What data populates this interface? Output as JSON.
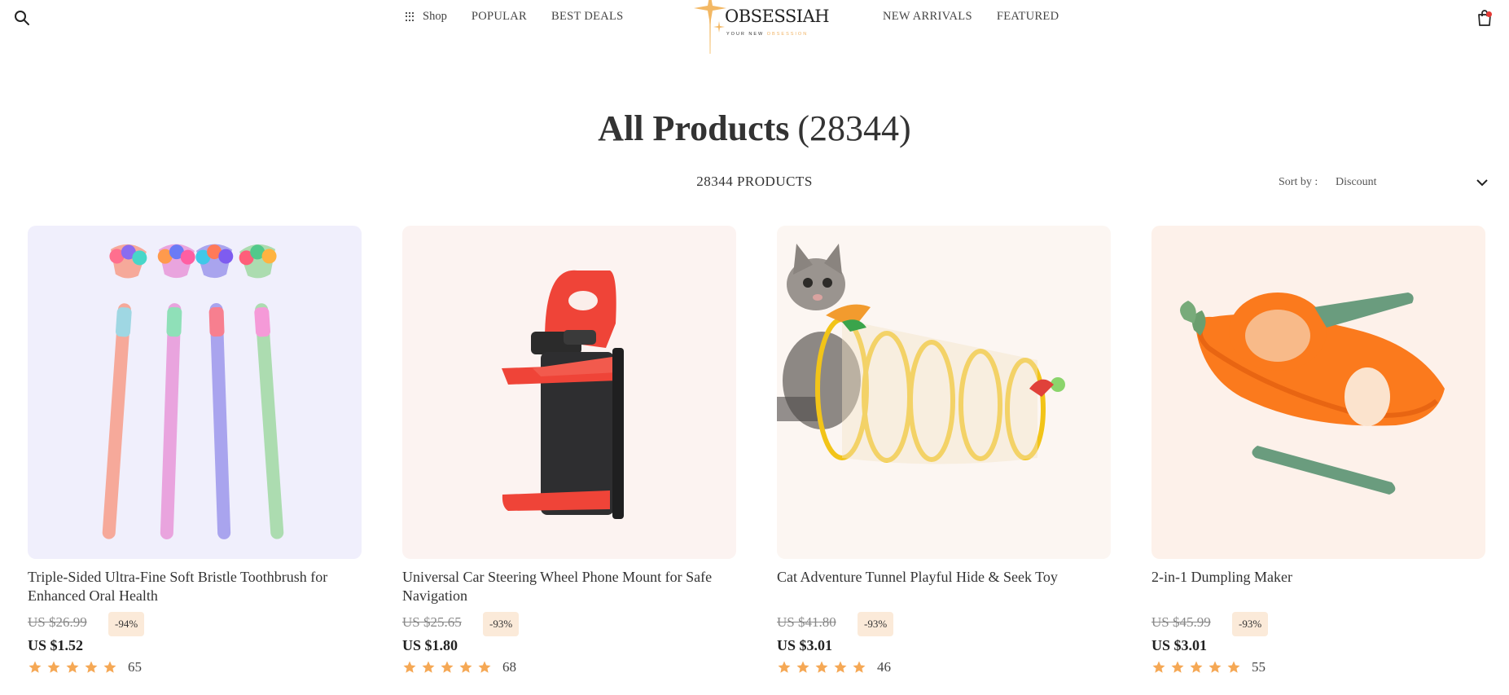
{
  "header": {
    "nav_left": [
      {
        "label": "Shop",
        "icon": "grid-icon"
      },
      {
        "label": "POPULAR"
      },
      {
        "label": "BEST DEALS"
      }
    ],
    "nav_right": [
      {
        "label": "NEW ARRIVALS"
      },
      {
        "label": "FEATURED"
      }
    ],
    "logo": {
      "word": "OBSESSIAH",
      "tagline_plain": "YOUR NEW",
      "tagline_accent": "OBSESSION"
    },
    "icons": {
      "search": "search-icon",
      "cart": "shopping-bag-icon"
    }
  },
  "page": {
    "title": "All Products",
    "title_count": "(28344)",
    "count_label": "28344 PRODUCTS",
    "sort_label": "Sort by :",
    "sort_value": "Discount"
  },
  "colors": {
    "star": "#f5a855",
    "badge_bg": "#fbead9",
    "cart_dot": "#e53935",
    "logo_gold": "#f0b262"
  },
  "products": [
    {
      "name": "Triple-Sided Ultra-Fine Soft Bristle Toothbrush for Enhanced Oral Health",
      "old_price": "US $26.99",
      "discount": "-94%",
      "price": "US $1.52",
      "rating": 5,
      "reviews": "65",
      "image_bg": "#f0effc"
    },
    {
      "name": "Universal Car Steering Wheel Phone Mount for Safe Navigation",
      "old_price": "US $25.65",
      "discount": "-93%",
      "price": "US $1.80",
      "rating": 5,
      "reviews": "68",
      "image_bg": "#fcf3f1"
    },
    {
      "name": "Cat Adventure Tunnel Playful Hide & Seek Toy",
      "old_price": "US $41.80",
      "discount": "-93%",
      "price": "US $3.01",
      "rating": 5,
      "reviews": "46",
      "image_bg": "#fcf6f2"
    },
    {
      "name": "2-in-1 Dumpling Maker",
      "old_price": "US $45.99",
      "discount": "-93%",
      "price": "US $3.01",
      "rating": 5,
      "reviews": "55",
      "image_bg": "#fdf1ea"
    }
  ]
}
